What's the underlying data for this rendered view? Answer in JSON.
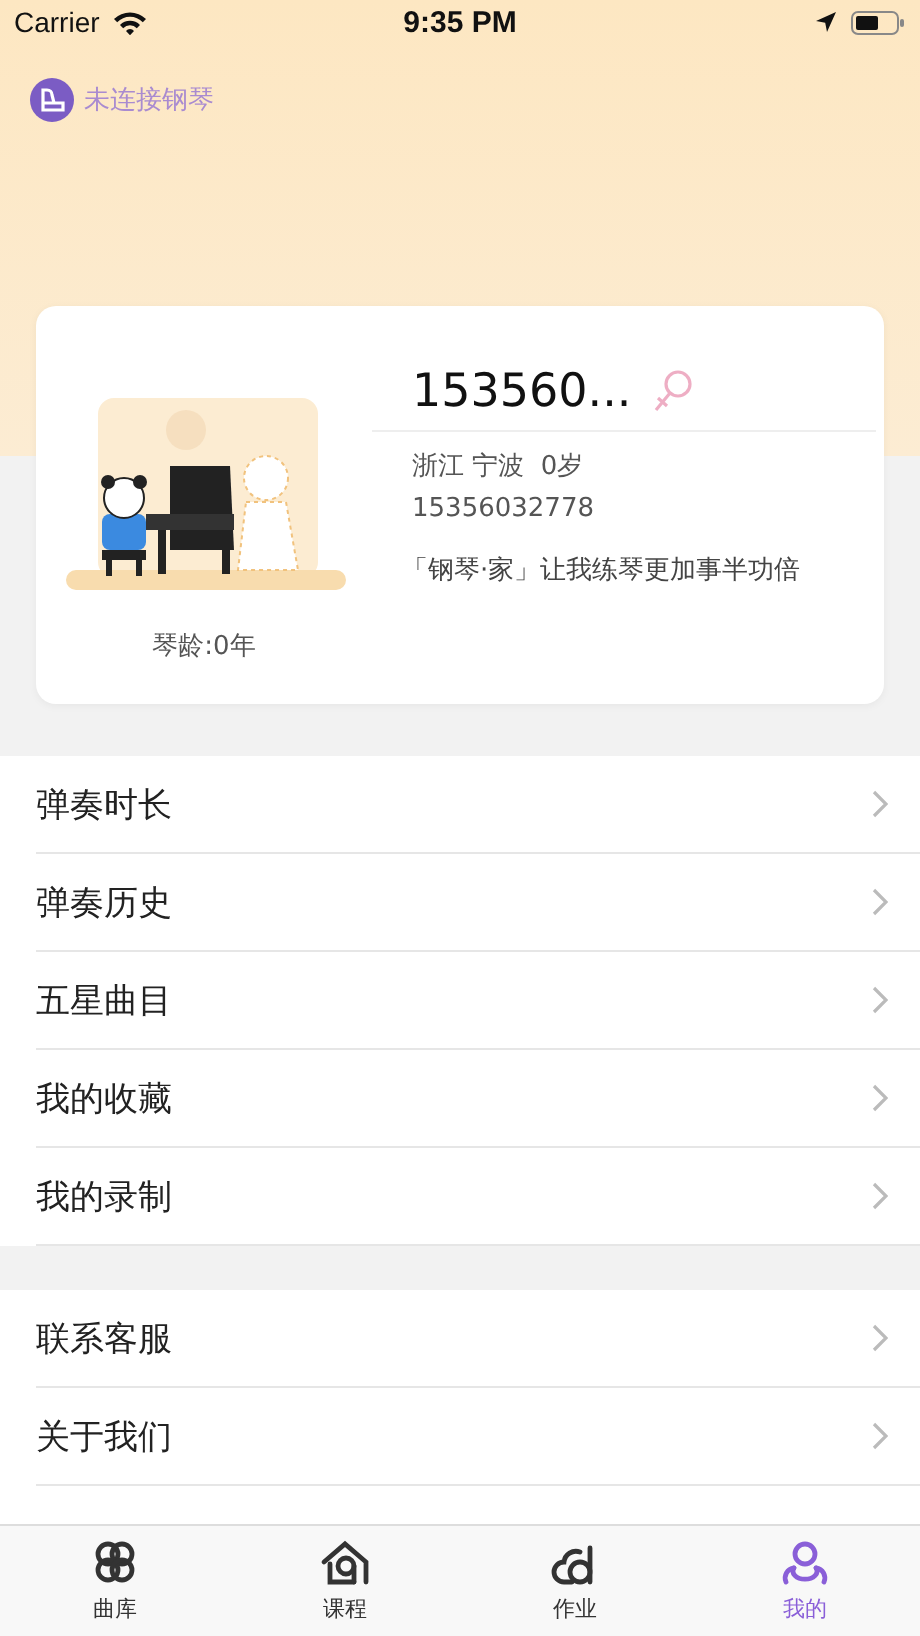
{
  "status_bar": {
    "carrier": "Carrier",
    "time": "9:35 PM"
  },
  "connection": {
    "label": "未连接钢琴"
  },
  "profile": {
    "name": "153560...",
    "female": true,
    "location": "浙江 宁波  0岁",
    "phone": "15356032778",
    "slogan": "「钢琴·家」让我练琴更加事半功倍",
    "piano_age": "琴龄:0年"
  },
  "menu_groups": [
    [
      "弹奏时长",
      "弹奏历史",
      "五星曲目",
      "我的收藏",
      "我的录制"
    ],
    [
      "联系客服",
      "关于我们"
    ]
  ],
  "tab_bar": [
    {
      "label": "曲库",
      "selected": false
    },
    {
      "label": "课程",
      "selected": false
    },
    {
      "label": "作业",
      "selected": false
    },
    {
      "label": "我的",
      "selected": true
    }
  ]
}
